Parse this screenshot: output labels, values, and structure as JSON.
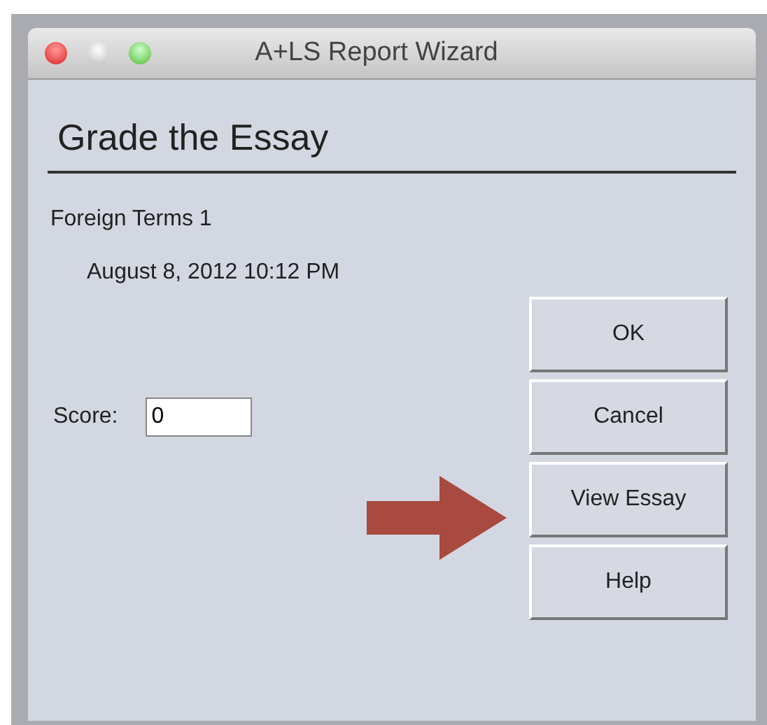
{
  "window": {
    "title": "A+LS Report Wizard"
  },
  "heading": "Grade the Essay",
  "item_name": "Foreign Terms 1",
  "date": "August 8, 2012 10:12 PM",
  "score": {
    "label": "Score:",
    "value": "0"
  },
  "buttons": [
    "OK",
    "Cancel",
    "View Essay",
    "Help"
  ]
}
